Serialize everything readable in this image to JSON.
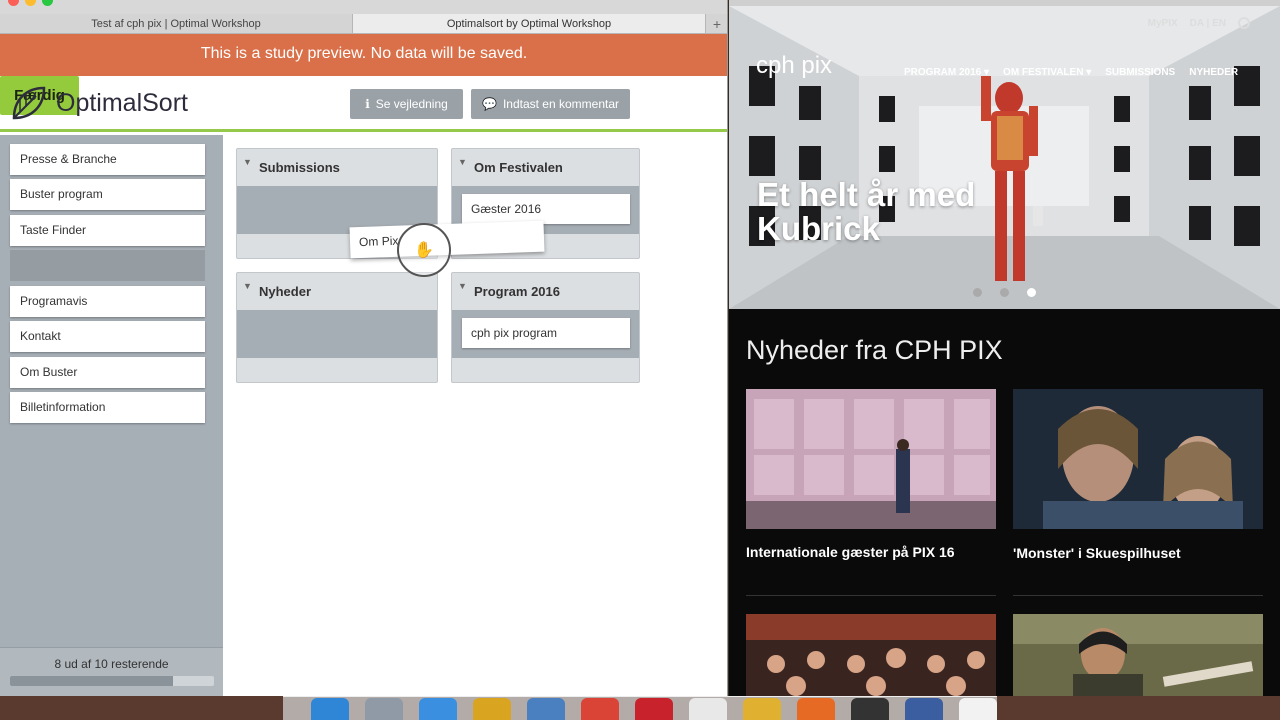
{
  "browser_left": {
    "tabs": [
      {
        "label": "Test af cph pix | Optimal Workshop",
        "active": false
      },
      {
        "label": "Optimalsort by Optimal Workshop",
        "active": true
      }
    ],
    "new_tab": "+"
  },
  "banner": {
    "text": "This is a study preview. No data will be saved."
  },
  "header": {
    "logo": "OptimalSort",
    "guide_label": "Se vejledning",
    "comment_label": "Indtast en kommentar",
    "done_label": "Færdig"
  },
  "sidebar": {
    "cards": [
      "Presse & Branche",
      "Buster program",
      "Taste Finder",
      "",
      "Programavis",
      "Kontakt",
      "Om Buster",
      "Billetinformation"
    ],
    "remaining_text": "8 ud af 10 resterende",
    "progress_fraction": 0.8
  },
  "groups": [
    {
      "title": "Submissions",
      "cards": []
    },
    {
      "title": "Om Festivalen",
      "cards": [
        "Gæster 2016"
      ]
    },
    {
      "title": "Nyheder",
      "cards": []
    },
    {
      "title": "Program 2016",
      "cards": [
        "cph pix program"
      ]
    }
  ],
  "dragging_card": "Om Pix",
  "site": {
    "logo": "cph pix",
    "top_links": [
      "MyPIX",
      "DA | EN"
    ],
    "nav": [
      "PROGRAM 2016 ▾",
      "OM FESTIVALEN ▾",
      "SUBMISSIONS",
      "NYHEDER"
    ],
    "hero_title_1": "Et helt år med",
    "hero_title_2": "Kubrick",
    "news_heading": "Nyheder fra CPH PIX",
    "articles": [
      "Internationale gæster på PIX 16",
      "'Monster' i Skuespilhuset"
    ]
  },
  "colors": {
    "banner": "#d9704a",
    "accent_green": "#94cb3d",
    "sidebar": "#a7afb6"
  }
}
